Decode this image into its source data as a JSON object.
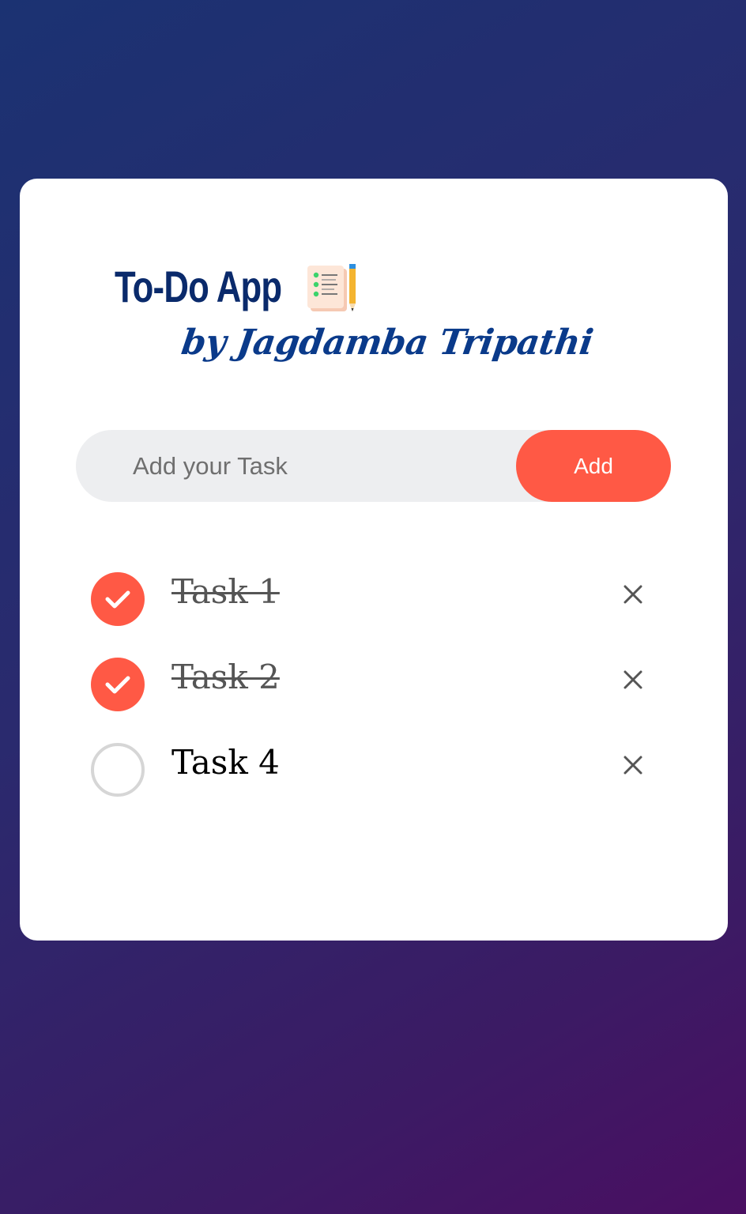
{
  "app": {
    "title": "To-Do App",
    "title_icon": "checklist-notepad-pencil-icon",
    "subtitle": "by Jagdamba Tripathi"
  },
  "input": {
    "placeholder": "Add your Task",
    "value": "",
    "add_label": "Add"
  },
  "tasks": [
    {
      "text": "Task 1",
      "completed": true
    },
    {
      "text": "Task 2",
      "completed": true
    },
    {
      "text": "Task 4",
      "completed": false
    }
  ],
  "colors": {
    "accent": "#ff5945",
    "title": "#0a2a6b",
    "subtitle": "#0a3a8a",
    "input_bg": "#edeef0",
    "background_start": "#1b3272",
    "background_end": "#4a0f62"
  },
  "icons": {
    "check": "checkmark-icon",
    "delete": "close-icon"
  }
}
